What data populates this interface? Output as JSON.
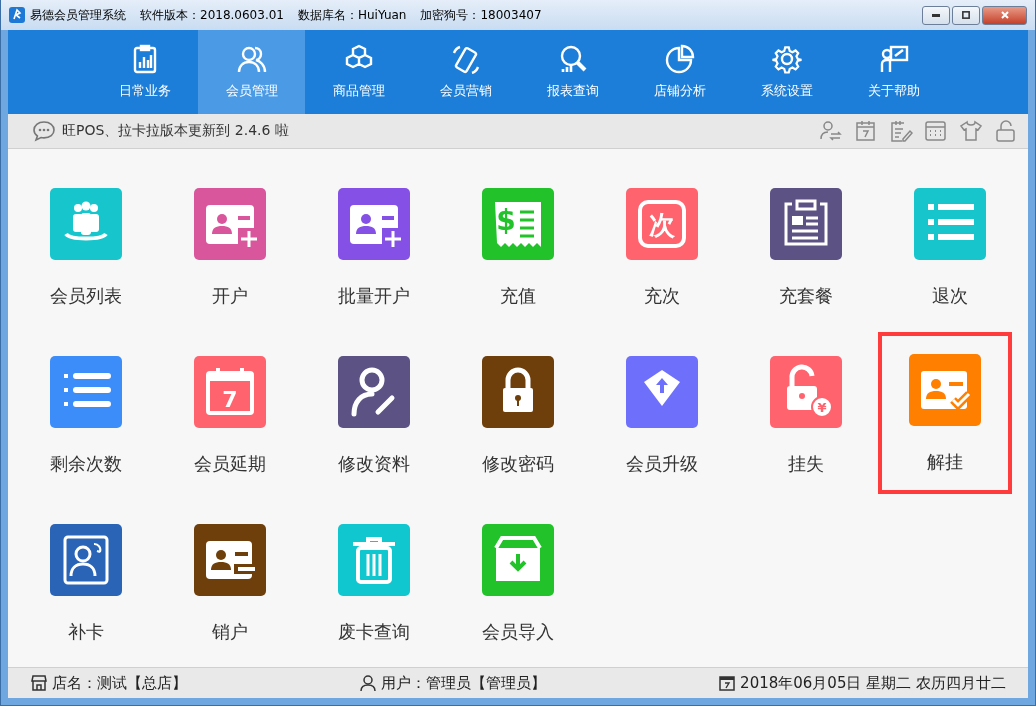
{
  "window": {
    "title": "易德会员管理系统",
    "info": [
      "软件版本：2018.0603.01",
      "数据库名：HuiYuan",
      "加密狗号：18003407"
    ]
  },
  "nav": [
    {
      "label": "日常业务",
      "selected": false
    },
    {
      "label": "会员管理",
      "selected": true
    },
    {
      "label": "商品管理",
      "selected": false
    },
    {
      "label": "会员营销",
      "selected": false
    },
    {
      "label": "报表查询",
      "selected": false
    },
    {
      "label": "店铺分析",
      "selected": false
    },
    {
      "label": "系统设置",
      "selected": false
    },
    {
      "label": "关于帮助",
      "selected": false
    }
  ],
  "notice": "旺POS、拉卡拉版本更新到 2.4.6 啦",
  "tiles": [
    {
      "label": "会员列表",
      "color": "#17c5cc",
      "highlighted": false
    },
    {
      "label": "开户",
      "color": "#d9559c",
      "highlighted": false
    },
    {
      "label": "批量开户",
      "color": "#8450e6",
      "highlighted": false
    },
    {
      "label": "充值",
      "glyph": "$",
      "color": "#22c22a",
      "highlighted": false
    },
    {
      "label": "充次",
      "glyph": "次",
      "color": "#ff636e",
      "highlighted": false
    },
    {
      "label": "充套餐",
      "color": "#5c5283",
      "highlighted": false
    },
    {
      "label": "退次",
      "color": "#17c5cc",
      "highlighted": false
    },
    {
      "label": "剩余次数",
      "color": "#3c8cfa",
      "highlighted": false
    },
    {
      "label": "会员延期",
      "glyph": "7",
      "color": "#ff636e",
      "highlighted": false
    },
    {
      "label": "修改资料",
      "color": "#5c5283",
      "highlighted": false
    },
    {
      "label": "修改密码",
      "color": "#6e3f0a",
      "highlighted": false
    },
    {
      "label": "会员升级",
      "color": "#6e6ffa",
      "highlighted": false
    },
    {
      "label": "挂失",
      "glyph": "¥",
      "color": "#ff636e",
      "highlighted": false
    },
    {
      "label": "解挂",
      "color": "#ff7f00",
      "highlighted": true
    },
    {
      "label": "补卡",
      "color": "#2a64b7",
      "highlighted": false
    },
    {
      "label": "销户",
      "color": "#6e3f0a",
      "highlighted": false
    },
    {
      "label": "废卡查询",
      "color": "#10c6cf",
      "highlighted": false
    },
    {
      "label": "会员导入",
      "color": "#22c22a",
      "highlighted": false
    }
  ],
  "status_bar": {
    "store": "店名：测试【总店】",
    "user": "用户：管理员【管理员】",
    "date": "2018年06月05日 星期二 农历四月廿二"
  }
}
